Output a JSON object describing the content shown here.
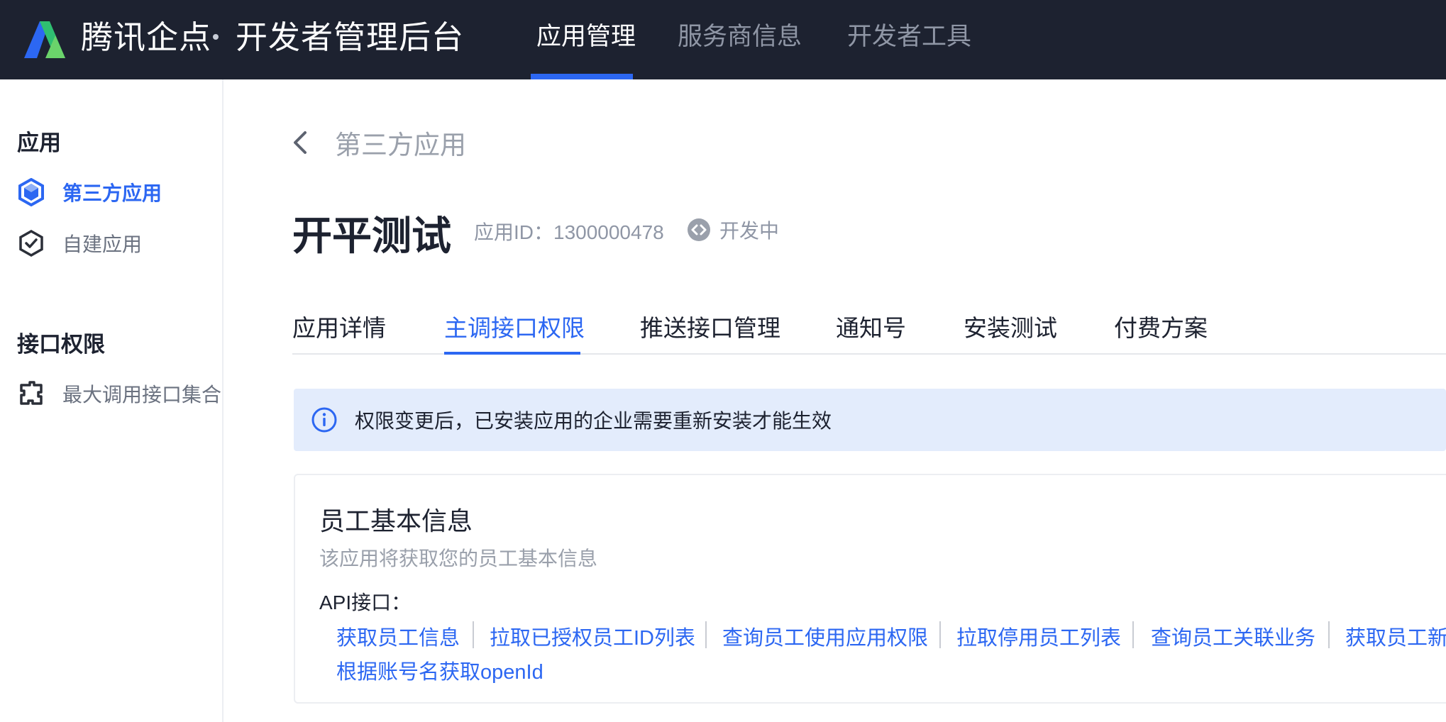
{
  "header": {
    "brand": "腾讯企点",
    "subtitle": "开发者管理后台",
    "nav": [
      {
        "label": "应用管理",
        "active": true
      },
      {
        "label": "服务商信息",
        "active": false
      },
      {
        "label": "开发者工具",
        "active": false
      }
    ]
  },
  "sidebar": {
    "group1": "应用",
    "items1": [
      {
        "label": "第三方应用",
        "icon": "hexagon-cube-icon",
        "active": true
      },
      {
        "label": "自建应用",
        "icon": "hexagon-check-icon",
        "active": false
      }
    ],
    "group2": "接口权限",
    "items2": [
      {
        "label": "最大调用接口集合",
        "icon": "puzzle-icon",
        "active": false
      }
    ]
  },
  "main": {
    "back_label": "第三方应用",
    "app_title": "开平测试",
    "app_id": "应用ID：1300000478",
    "status": "开发中",
    "tabs": [
      {
        "label": "应用详情",
        "active": false
      },
      {
        "label": "主调接口权限",
        "active": true
      },
      {
        "label": "推送接口管理",
        "active": false
      },
      {
        "label": "通知号",
        "active": false
      },
      {
        "label": "安装测试",
        "active": false
      },
      {
        "label": "付费方案",
        "active": false
      }
    ],
    "notice": "权限变更后，已安装应用的企业需要重新安装才能生效",
    "card": {
      "title": "员工基本信息",
      "desc": "该应用将获取您的员工基本信息",
      "api_label": "API接口：",
      "apis": [
        "获取员工信息",
        "拉取已授权员工ID列表",
        "查询员工使用应用权限",
        "拉取停用员工列表",
        "查询员工关联业务",
        "获取员工新",
        "根据账号名获取openId"
      ]
    }
  },
  "colors": {
    "topbar": "#1d2230",
    "accent": "#2c67f2",
    "notice_bg": "#e3ecfc"
  }
}
